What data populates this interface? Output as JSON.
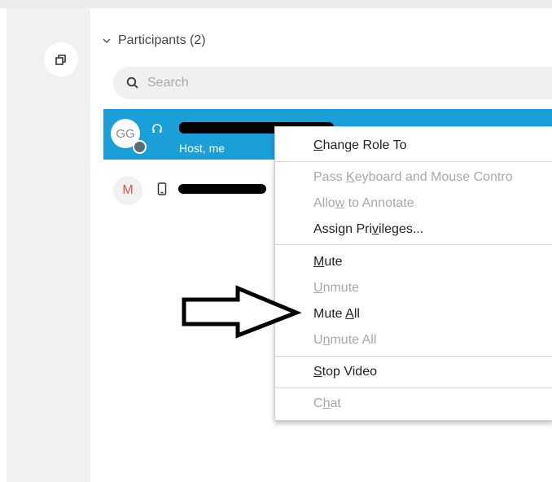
{
  "panel": {
    "participants_header": "Participants (2)",
    "search": {
      "placeholder": "Search",
      "value": ""
    }
  },
  "participants": [
    {
      "avatar_initials": "GG",
      "role": "Host, me",
      "device_icon": "headset-icon",
      "selected": true
    },
    {
      "avatar_initials": "M",
      "device_icon": "phone-icon",
      "selected": false
    }
  ],
  "context_menu": {
    "items": [
      {
        "label": "Change Role To",
        "underline": "C",
        "enabled": true
      },
      {
        "label": "Pass Keyboard and Mouse Contro",
        "underline": "K",
        "enabled": false
      },
      {
        "label": "Allow to Annotate",
        "underline": "w",
        "enabled": false
      },
      {
        "label": "Assign Privileges...",
        "underline": "v",
        "enabled": true
      },
      {
        "label": "Mute",
        "underline": "M",
        "enabled": true
      },
      {
        "label": "Unmute",
        "underline": "U",
        "enabled": false
      },
      {
        "label": "Mute All",
        "underline": "A",
        "enabled": true
      },
      {
        "label": "Unmute All",
        "underline": "n",
        "enabled": false
      },
      {
        "label": "Stop Video",
        "underline": "S",
        "enabled": true
      },
      {
        "label": "Chat",
        "underline": "h",
        "enabled": false
      }
    ]
  },
  "colors": {
    "selection": "#1a9fd9",
    "rail": "#f1f1f1",
    "disabled_text": "#a8a8a8",
    "avatar_m": "#d9534f"
  }
}
